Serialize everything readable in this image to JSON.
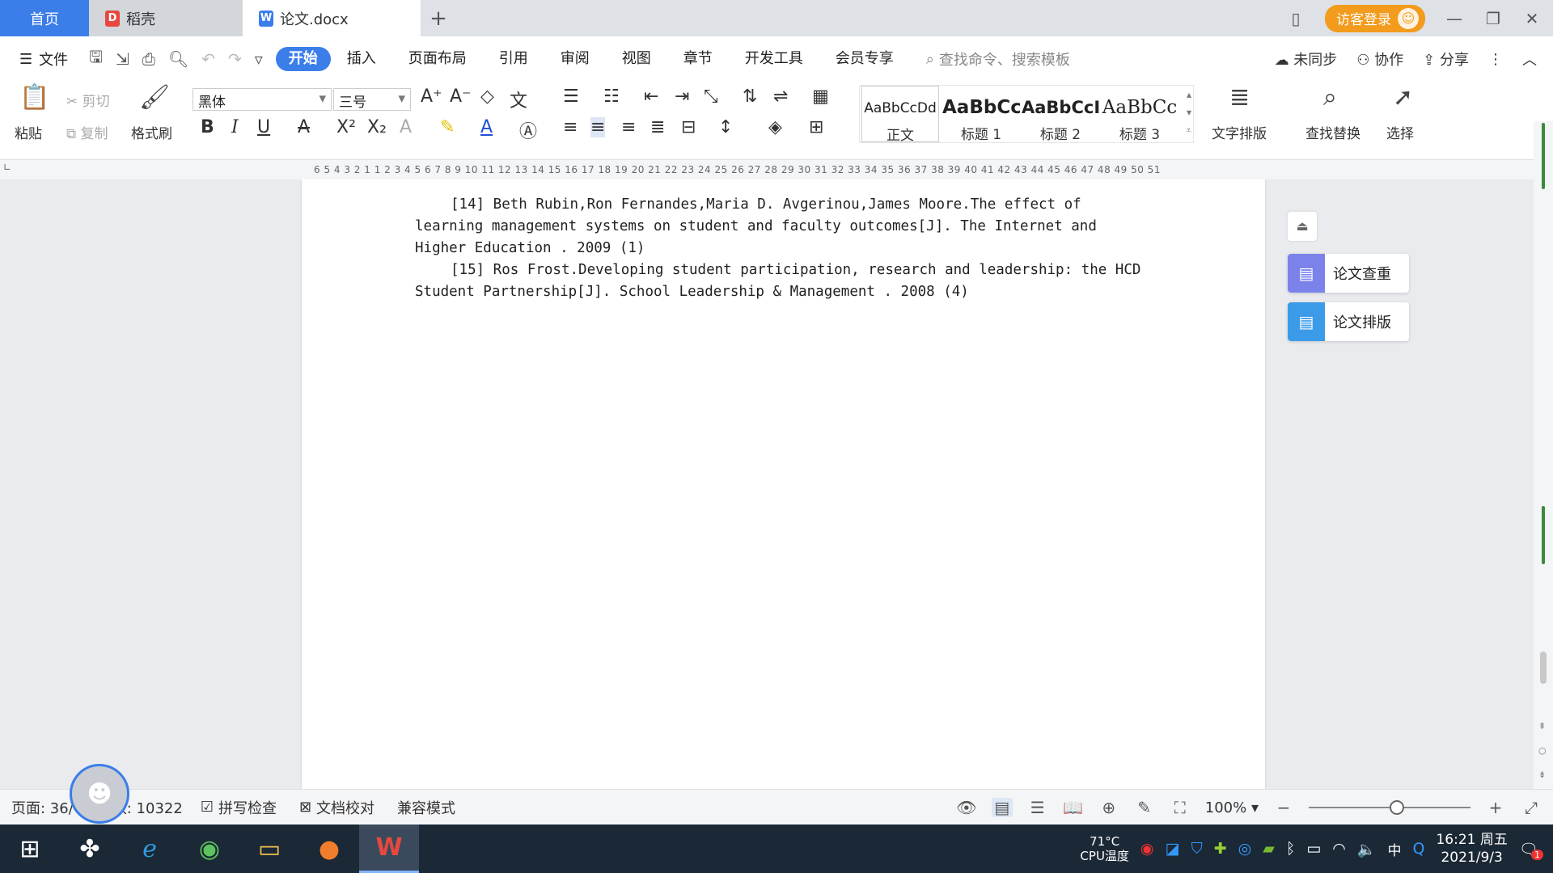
{
  "tabs": {
    "home": "首页",
    "docer": "稻壳",
    "document": "论文.docx",
    "new_tab": "+"
  },
  "window": {
    "login": "访客登录"
  },
  "menu": {
    "file": "文件",
    "tabs": [
      "开始",
      "插入",
      "页面布局",
      "引用",
      "审阅",
      "视图",
      "章节",
      "开发工具",
      "会员专享"
    ],
    "search_placeholder": "查找命令、搜索模板",
    "sync": "未同步",
    "collab": "协作",
    "share": "分享"
  },
  "ribbon": {
    "paste": "粘贴",
    "cut": "剪切",
    "copy": "复制",
    "format_painter": "格式刷",
    "font_name": "黑体",
    "font_size": "三号",
    "styles": [
      {
        "sample": "AaBbCcDd",
        "name": "正文"
      },
      {
        "sample": "AaBbCc",
        "name": "标题 1"
      },
      {
        "sample": "AaBbCcI",
        "name": "标题 2"
      },
      {
        "sample": "AaBbCc",
        "name": "标题 3"
      }
    ],
    "text_layout": "文字排版",
    "find_replace": "查找替换",
    "select": "选择"
  },
  "ruler": {
    "numbers": "6 5 4 3 2 1   1 2 3 4 5 6 7 8 9 10 11 12 13 14 15 16 17 18 19 20 21 22 23 24 25 26 27 28 29 30 31 32 33 34 35 36 37 38 39 40 41 42 43 44 45 46 47 48 49 50 51"
  },
  "document": {
    "ref14": "[14] Beth Rubin,Ron Fernandes,Maria D. Avgerinou,James Moore.The effect of learning management systems on student and faculty outcomes[J]. The Internet and Higher Education . 2009 (1)",
    "ref15": "[15] Ros Frost.Developing student participation, research and leadership: the HCD Student Partnership[J]. School Leadership & Management . 2008 (4)"
  },
  "side_panel": {
    "plagiarism_check": "论文查重",
    "paper_format": "论文排版"
  },
  "status": {
    "page": "页面: 36/",
    "word_count": "数: 10322",
    "spell_check": "拼写检查",
    "proofread": "文档校对",
    "compat_mode": "兼容模式",
    "zoom": "100%"
  },
  "taskbar": {
    "cpu_temp": "71°C",
    "cpu_label": "CPU温度",
    "ime": "中",
    "time": "16:21 周五",
    "date": "2021/9/3",
    "notify_count": "1"
  },
  "colors": {
    "accent": "#3b7de9",
    "login_orange": "#f29b1d",
    "taskbar": "#1b2836"
  }
}
